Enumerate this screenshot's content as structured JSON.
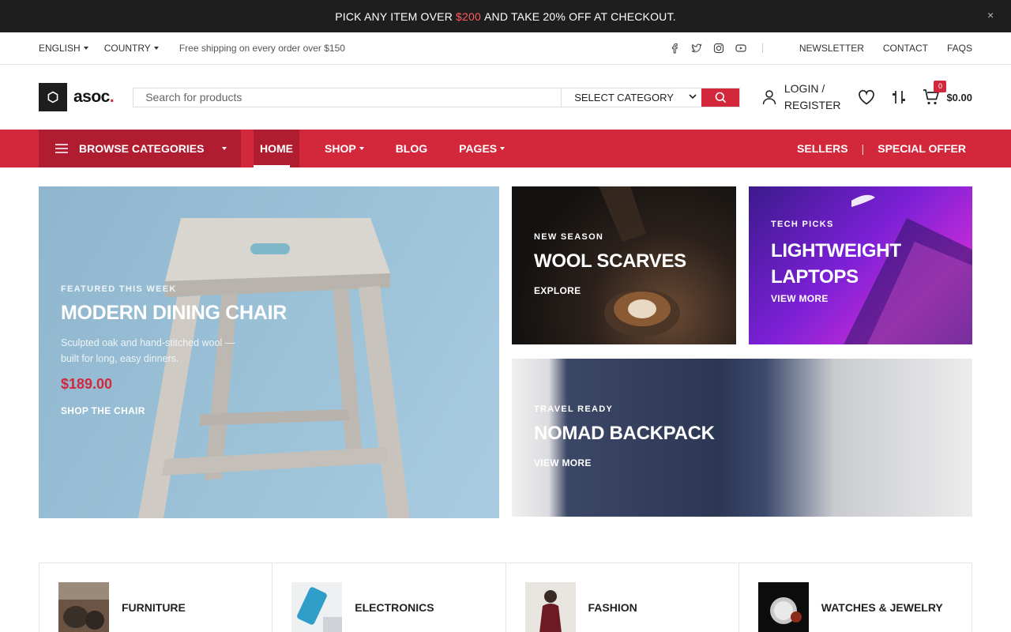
{
  "announcement": {
    "pre": "PICK ANY ITEM OVER",
    "highlight": "$200",
    "post": "AND TAKE 20% OFF AT CHECKOUT.",
    "close_glyph": "×"
  },
  "topbar": {
    "language": "ENGLISH",
    "country": "COUNTRY",
    "shipping": "Free shipping on every order over $150",
    "social_icons": [
      "facebook-icon",
      "twitter-icon",
      "instagram-icon",
      "youtube-icon"
    ],
    "links": [
      "NEWSLETTER",
      "CONTACT",
      "FAQS"
    ]
  },
  "header": {
    "logo_text": "asoc",
    "logo_dot": ".",
    "search_placeholder": "Search for products",
    "category_select": "SELECT CATEGORY",
    "login_line1": "LOGIN /",
    "login_line2": "REGISTER",
    "cart_count": "0",
    "cart_total": "$0.00"
  },
  "nav": {
    "browse": "BROWSE CATEGORIES",
    "items": [
      "HOME",
      "SHOP",
      "BLOG",
      "PAGES"
    ],
    "active": "HOME",
    "sellers": "SELLERS",
    "divider": "|",
    "special_offer": "SPECIAL OFFER"
  },
  "banners": {
    "chair": {
      "kicker": "FEATURED THIS WEEK",
      "title": "MODERN DINING CHAIR",
      "desc": "Sculpted oak and hand-stitched wool — built for long, easy dinners.",
      "price": "$189.00",
      "link": "SHOP THE CHAIR"
    },
    "scarf": {
      "kicker": "NEW SEASON",
      "title": "WOOL SCARVES",
      "link": "EXPLORE"
    },
    "laptop": {
      "kicker": "TECH PICKS",
      "title": "LIGHTWEIGHT LAPTOPS",
      "link": "VIEW MORE"
    },
    "bag": {
      "kicker": "TRAVEL READY",
      "title": "NOMAD BACKPACK",
      "link": "VIEW MORE"
    }
  },
  "categories": [
    "FURNITURE",
    "ELECTRONICS",
    "FASHION",
    "WATCHES & JEWELRY"
  ],
  "colors": {
    "accent": "#d3283c",
    "accent_dark": "#b11d30",
    "dark": "#1e1e1e"
  }
}
